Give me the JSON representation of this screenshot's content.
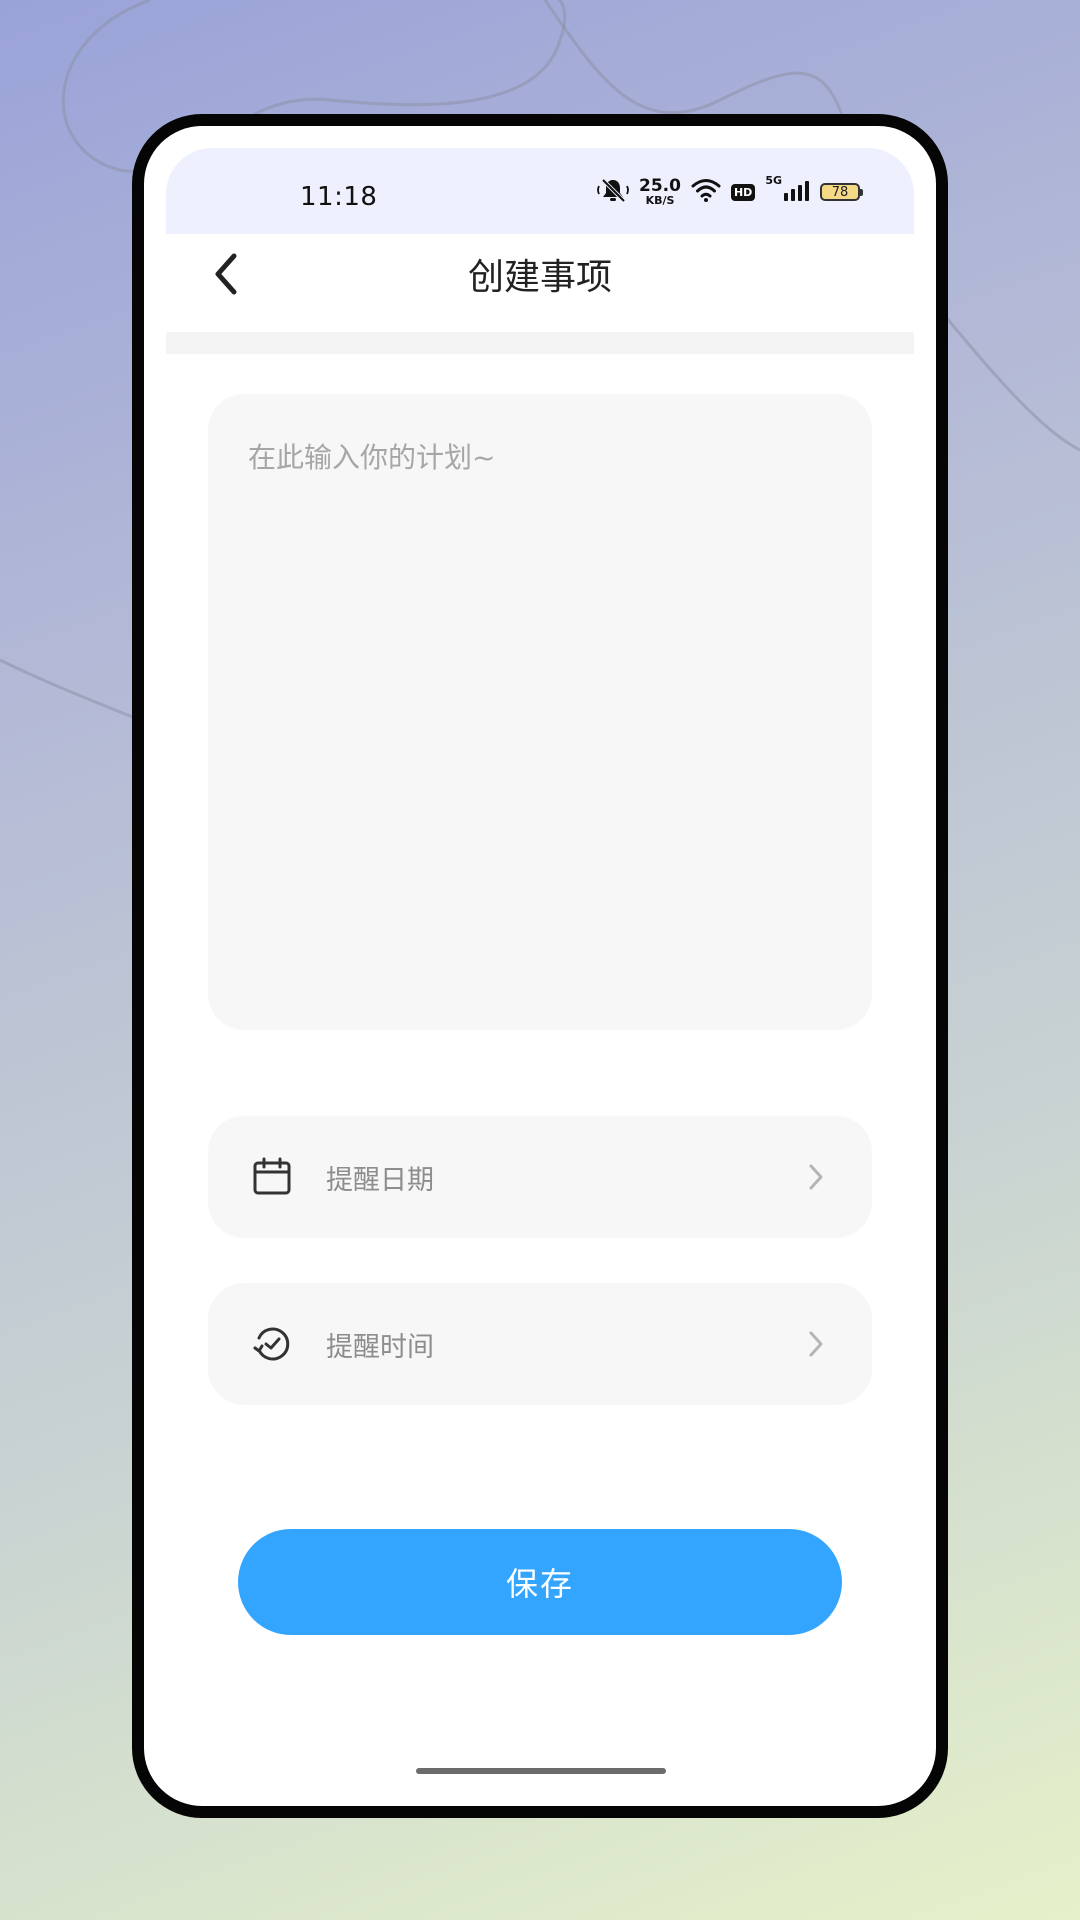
{
  "status_bar": {
    "time": "11:18",
    "net_speed_value": "25.0",
    "net_speed_unit": "KB/S",
    "hd_badge": "HD",
    "network_type": "5G",
    "battery_level": "78",
    "icons": [
      "mute-icon",
      "wifi-icon",
      "signal-icon",
      "battery-icon"
    ]
  },
  "header": {
    "title": "创建事项",
    "back_icon": "chevron-left-icon"
  },
  "plan": {
    "placeholder": "在此输入你的计划~",
    "value": ""
  },
  "reminder": {
    "date": {
      "label": "提醒日期",
      "icon": "calendar-icon"
    },
    "time": {
      "label": "提醒时间",
      "icon": "clock-icon"
    }
  },
  "actions": {
    "save_label": "保存"
  },
  "colors": {
    "accent": "#33a5ff",
    "status_bar_bg": "#eef1fd",
    "field_bg": "#f7f7f7",
    "battery_fill": "#f4d987"
  }
}
